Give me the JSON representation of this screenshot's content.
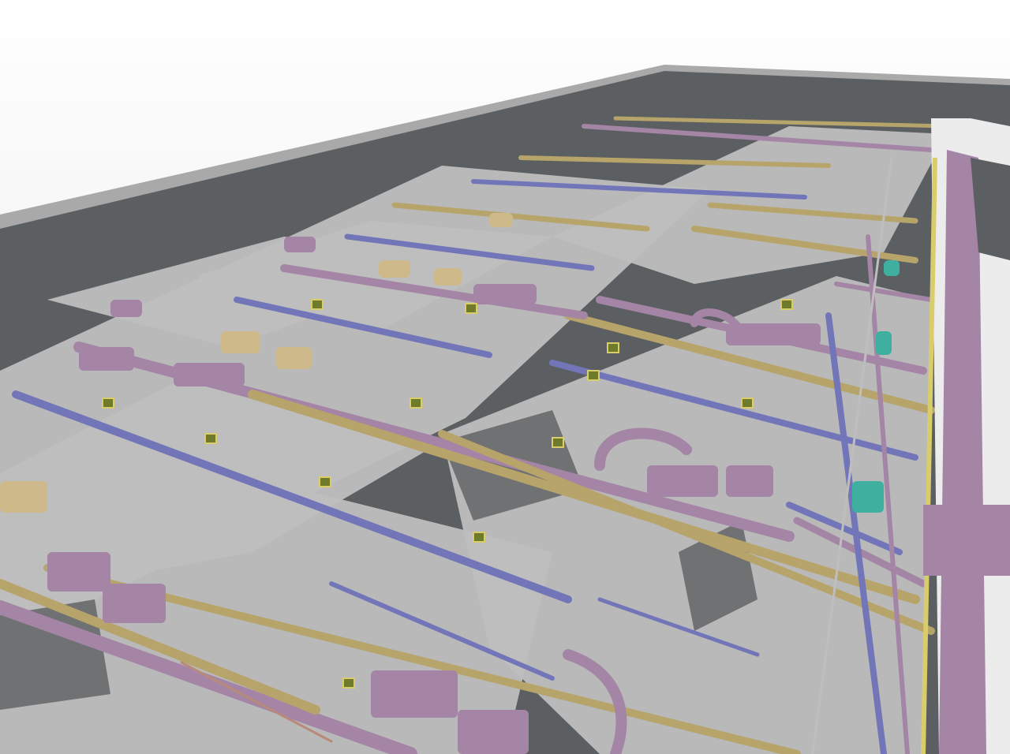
{
  "scene": {
    "palette": {
      "sky_top": "#ffffff",
      "sky_bottom": "#e3e3e3",
      "slab_edge": "#a9a9a9",
      "roof_dark": "#5c5f61",
      "floor_plate": "#bebebe",
      "floor_shadow": "#6f7173",
      "duct_purple": "#a485a6",
      "duct_purple_dark": "#7a5f7c",
      "pipe_gold": "#b7a46a",
      "pipe_gold_dark": "#8a7a48",
      "pipe_blue": "#7276b8",
      "pipe_blue_dark": "#4d5093",
      "equipment_tan": "#cdb98a",
      "cable_copper": "#b88a7a",
      "accent_teal": "#3fb0a0",
      "accent_yellow": "#d9cc6a",
      "sensor_green": "#6f7a2a"
    }
  }
}
